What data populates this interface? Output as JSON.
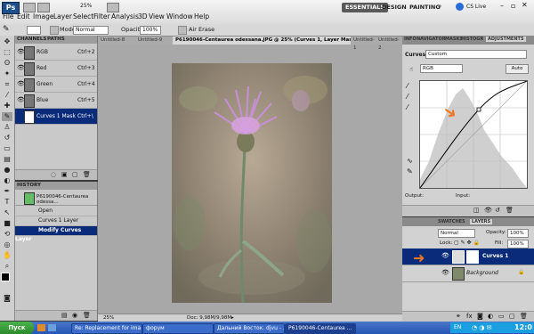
{
  "app": {
    "logo": "Ps",
    "zoom": "25%"
  },
  "menu": [
    "File",
    "Edit",
    "Image",
    "Layer",
    "Select",
    "Filter",
    "Analysis",
    "3D",
    "View",
    "Window",
    "Help"
  ],
  "workspaces": [
    "ESSENTIALS",
    "DESIGN",
    "PAINTING"
  ],
  "cslive": "CS Live",
  "options": {
    "mode_label": "Mode:",
    "mode_value": "Normal",
    "opacity_label": "Opacity:",
    "opacity_value": "100%",
    "airbrush_label": "Air Erase"
  },
  "channels": {
    "tabs": [
      "CHANNELS",
      "PATHS"
    ],
    "rows": [
      {
        "name": "RGB",
        "key": "Ctrl+2"
      },
      {
        "name": "Red",
        "key": "Ctrl+3"
      },
      {
        "name": "Green",
        "key": "Ctrl+4"
      },
      {
        "name": "Blue",
        "key": "Ctrl+5"
      },
      {
        "name": "Curves 1 Mask",
        "key": "Ctrl+\\"
      }
    ]
  },
  "history": {
    "tab": "HISTORY",
    "snapshot": "P6190046-Centaurea odessa...",
    "rows": [
      "Open",
      "Curves 1 Layer",
      "Modify Curves Layer"
    ]
  },
  "document": {
    "tabs": [
      "Untitled-8",
      "Untitled-9",
      "P6190046-Centaurea odessana.JPG @ 25% (Curves 1, Layer Mask/8) *",
      "Untitled-1",
      "Untitled-2"
    ],
    "zoom": "25%",
    "doc_size": "Doc: 9,98M/9,98M"
  },
  "adjustments": {
    "tabs": [
      "INFO",
      "NAVIGATOR",
      "MASKS",
      "HISTOGR",
      "ADJUSTMENTS"
    ],
    "curves_label": "Curves",
    "preset": "Custom",
    "channel": "RGB",
    "auto": "Auto",
    "output": "Output:",
    "input": "Input:"
  },
  "layers": {
    "tabs": [
      "SWATCHES",
      "LAYERS"
    ],
    "blend": "Normal",
    "opacity_label": "Opacity:",
    "opacity": "100%",
    "lock_label": "Lock:",
    "fill_label": "Fill:",
    "fill": "100%",
    "items": [
      {
        "name": "Curves 1"
      },
      {
        "name": "Background"
      }
    ]
  },
  "taskbar": {
    "start": "Пуск",
    "items": [
      "Re: Replacement for ima...",
      "форум",
      "Дальний Восток. djvu - ...",
      "P6190046-Centaurea ..."
    ],
    "lang": "EN",
    "clock": "12:0"
  },
  "colors": {
    "accent_blue": "#0a2a7a",
    "arrow_orange": "#f07820"
  }
}
